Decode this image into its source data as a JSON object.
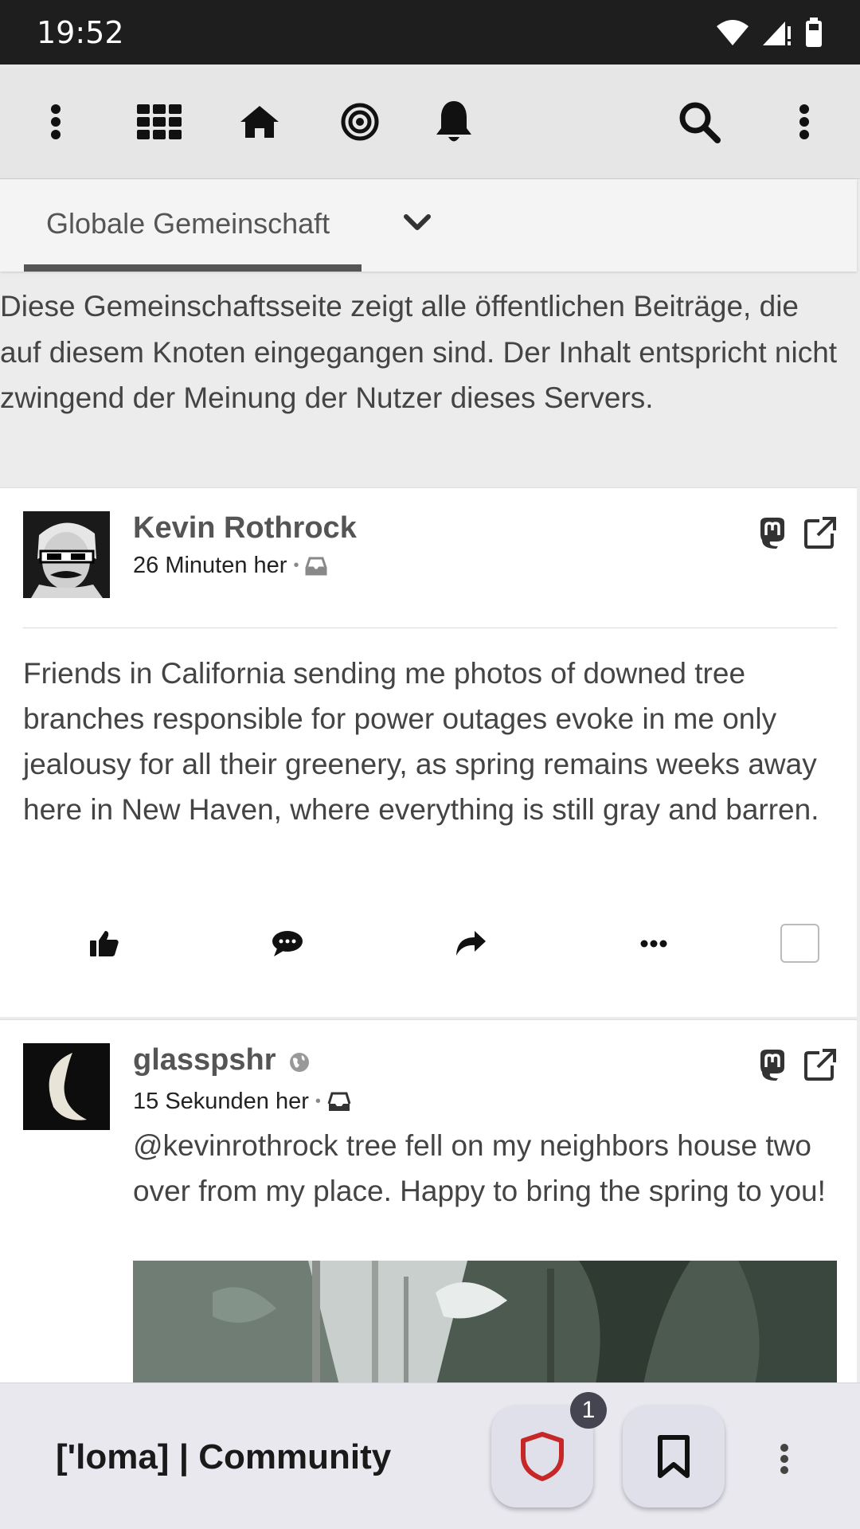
{
  "status_bar": {
    "time": "19:52"
  },
  "toolbar": {
    "icons": [
      "menu-dots-icon",
      "apps-grid-icon",
      "home-icon",
      "target-icon",
      "bell-icon",
      "search-icon",
      "more-icon"
    ]
  },
  "tabs": {
    "active_label": "Globale Gemeinschaft"
  },
  "description": "Diese Gemeinschaftsseite zeigt alle öffentlichen Beiträge, die auf diesem Knoten eingegangen sind. Der Inhalt entspricht nicht zwingend der Meinung der Nutzer dieses Servers.",
  "posts": [
    {
      "author": "Kevin Rothrock",
      "time": "26 Minuten her",
      "text": "Friends in California sending me photos of downed tree branches responsible for power outages evoke in me only jealousy for all their greenery, as spring remains weeks away here in New Haven, where everything is still gray and barren."
    },
    {
      "author": "glasspshr",
      "time": "15 Sekunden her",
      "text": "@kevinrothrock tree fell on my neighbors house two over from my place. Happy to bring the spring to you!"
    }
  ],
  "bottom_bar": {
    "title": "['loma] | Community",
    "badge_count": "1"
  },
  "colors": {
    "shield": "#c62828",
    "toolbar_bg": "#e6e6e6",
    "bottom_bar_bg": "#e9e8ef"
  }
}
